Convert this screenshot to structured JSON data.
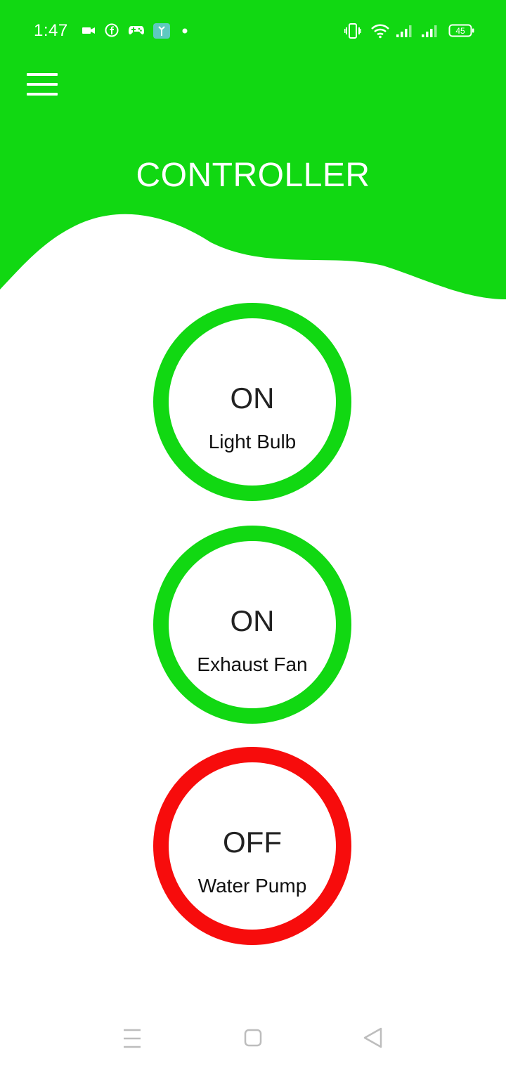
{
  "status_bar": {
    "time": "1:47",
    "battery": "45",
    "icons": [
      "video-camera-icon",
      "facebook-icon",
      "gamepad-icon",
      "app-notification-icon",
      "dot-icon",
      "vibrate-icon",
      "wifi-icon",
      "signal-icon",
      "signal-icon",
      "battery-icon"
    ]
  },
  "header": {
    "title": "CONTROLLER",
    "menu_icon": "hamburger-menu-icon",
    "color": "#11d812"
  },
  "devices": [
    {
      "state": "ON",
      "label": "Light Bulb",
      "color": "#11d812"
    },
    {
      "state": "ON",
      "label": "Exhaust Fan",
      "color": "#11d812"
    },
    {
      "state": "OFF",
      "label": "Water Pump",
      "color": "#f70c0c"
    }
  ],
  "nav_bar": {
    "icons": [
      "recents-menu-icon",
      "home-square-icon",
      "back-triangle-icon"
    ],
    "color": "#bdbdbd"
  }
}
